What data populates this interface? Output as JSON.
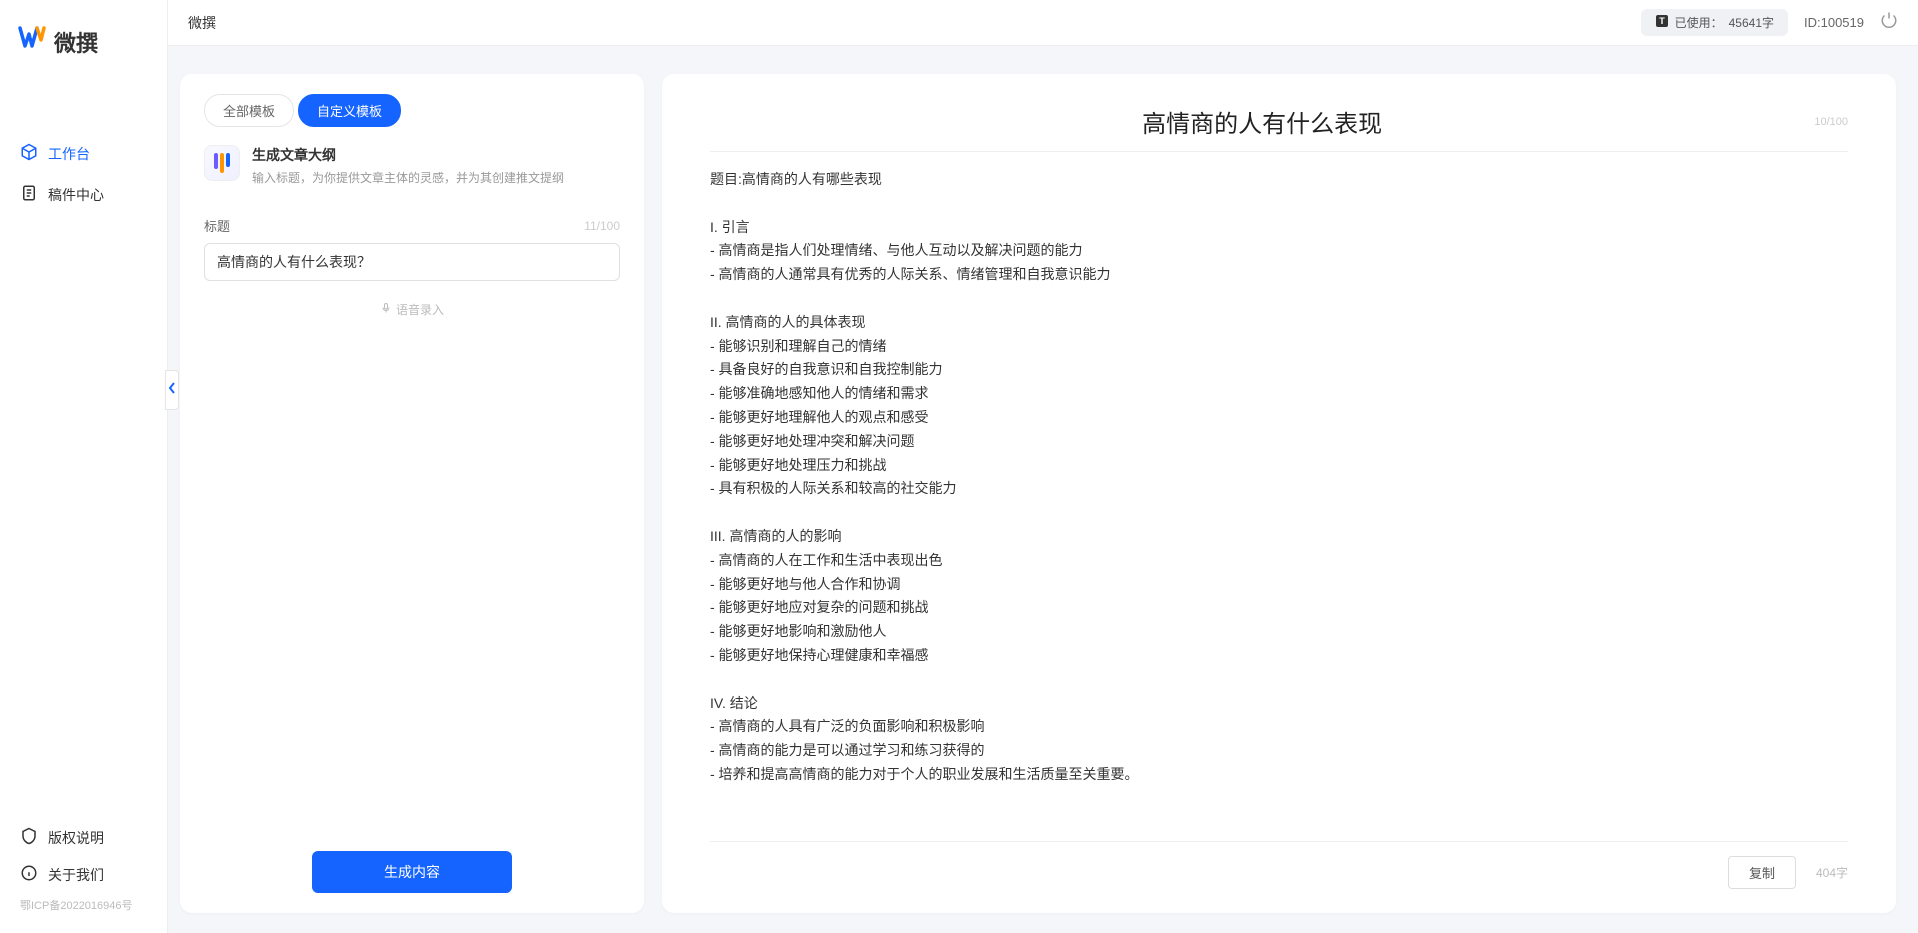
{
  "app": {
    "logo_text": "微撰",
    "title": "微撰"
  },
  "sidebar": {
    "items": [
      {
        "label": "工作台",
        "icon": "cube-icon",
        "active": true
      },
      {
        "label": "稿件中心",
        "icon": "document-icon",
        "active": false
      }
    ],
    "footer_items": [
      {
        "label": "版权说明",
        "icon": "shield-icon"
      },
      {
        "label": "关于我们",
        "icon": "info-icon"
      }
    ],
    "icp": "鄂ICP备2022016946号"
  },
  "topbar": {
    "usage_label": "已使用：",
    "usage_value": "45641字",
    "user_id": "ID:100519"
  },
  "left_panel": {
    "tabs": {
      "all": "全部模板",
      "custom": "自定义模板"
    },
    "template": {
      "title": "生成文章大纲",
      "desc": "输入标题，为你提供文章主体的灵感，并为其创建推文提纲"
    },
    "field_label": "标题",
    "char_count": "11/100",
    "input_value": "高情商的人有什么表现？",
    "voice_label": "语音录入",
    "generate_label": "生成内容"
  },
  "right_panel": {
    "title": "高情商的人有什么表现",
    "header_count": "10/100",
    "body": "题目:高情商的人有哪些表现\n\nI. 引言\n- 高情商是指人们处理情绪、与他人互动以及解决问题的能力\n- 高情商的人通常具有优秀的人际关系、情绪管理和自我意识能力\n\nII. 高情商的人的具体表现\n- 能够识别和理解自己的情绪\n- 具备良好的自我意识和自我控制能力\n- 能够准确地感知他人的情绪和需求\n- 能够更好地理解他人的观点和感受\n- 能够更好地处理冲突和解决问题\n- 能够更好地处理压力和挑战\n- 具有积极的人际关系和较高的社交能力\n\nIII. 高情商的人的影响\n- 高情商的人在工作和生活中表现出色\n- 能够更好地与他人合作和协调\n- 能够更好地应对复杂的问题和挑战\n- 能够更好地影响和激励他人\n- 能够更好地保持心理健康和幸福感\n\nIV. 结论\n- 高情商的人具有广泛的负面影响和积极影响\n- 高情商的能力是可以通过学习和练习获得的\n- 培养和提高高情商的能力对于个人的职业发展和生活质量至关重要。",
    "copy_label": "复制",
    "word_count": "404字"
  }
}
